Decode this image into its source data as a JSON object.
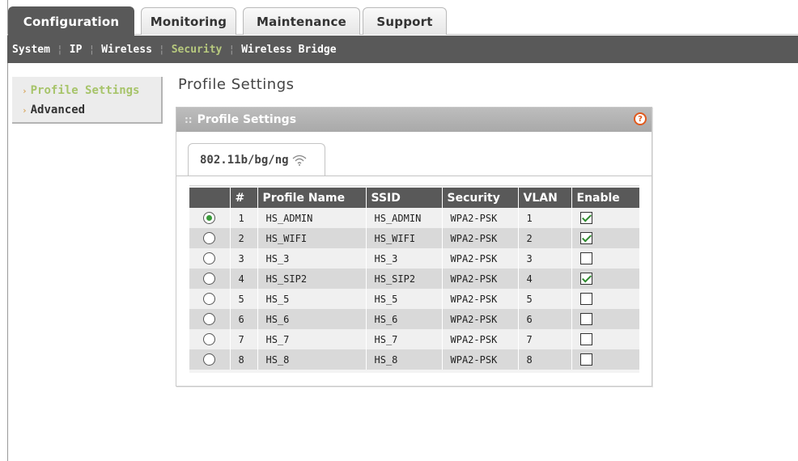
{
  "top_tabs": [
    {
      "label": "Configuration",
      "active": true
    },
    {
      "label": "Monitoring",
      "active": false
    },
    {
      "label": "Maintenance",
      "active": false
    },
    {
      "label": "Support",
      "active": false
    }
  ],
  "subnav": [
    {
      "label": "System",
      "active": false
    },
    {
      "label": "IP",
      "active": false
    },
    {
      "label": "Wireless",
      "active": false
    },
    {
      "label": "Security",
      "active": true
    },
    {
      "label": "Wireless Bridge",
      "active": false
    }
  ],
  "sidebar": {
    "items": [
      {
        "label": "Profile Settings",
        "active": true
      },
      {
        "label": "Advanced",
        "active": false
      }
    ]
  },
  "page": {
    "title": "Profile Settings",
    "panel_title": "Profile Settings",
    "help_icon": "help-icon",
    "band_tab": "802.11b/bg/ng",
    "band_icon": "wifi-icon"
  },
  "table": {
    "columns": [
      "",
      "#",
      "Profile Name",
      "SSID",
      "Security",
      "VLAN",
      "Enable"
    ],
    "rows": [
      {
        "selected": true,
        "num": "1",
        "profile": "HS_ADMIN",
        "ssid": "HS_ADMIN",
        "security": "WPA2-PSK",
        "vlan": "1",
        "enabled": true
      },
      {
        "selected": false,
        "num": "2",
        "profile": "HS_WIFI",
        "ssid": "HS_WIFI",
        "security": "WPA2-PSK",
        "vlan": "2",
        "enabled": true
      },
      {
        "selected": false,
        "num": "3",
        "profile": "HS_3",
        "ssid": "HS_3",
        "security": "WPA2-PSK",
        "vlan": "3",
        "enabled": false
      },
      {
        "selected": false,
        "num": "4",
        "profile": "HS_SIP2",
        "ssid": "HS_SIP2",
        "security": "WPA2-PSK",
        "vlan": "4",
        "enabled": true
      },
      {
        "selected": false,
        "num": "5",
        "profile": "HS_5",
        "ssid": "HS_5",
        "security": "WPA2-PSK",
        "vlan": "5",
        "enabled": false
      },
      {
        "selected": false,
        "num": "6",
        "profile": "HS_6",
        "ssid": "HS_6",
        "security": "WPA2-PSK",
        "vlan": "6",
        "enabled": false
      },
      {
        "selected": false,
        "num": "7",
        "profile": "HS_7",
        "ssid": "HS_7",
        "security": "WPA2-PSK",
        "vlan": "7",
        "enabled": false
      },
      {
        "selected": false,
        "num": "8",
        "profile": "HS_8",
        "ssid": "HS_8",
        "security": "WPA2-PSK",
        "vlan": "8",
        "enabled": false
      }
    ]
  },
  "colors": {
    "nav_bg": "#595959",
    "active_sub": "#b7c97e",
    "active_side": "#a7c46a",
    "help": "#e05a1e",
    "check": "#2f8a2f"
  }
}
